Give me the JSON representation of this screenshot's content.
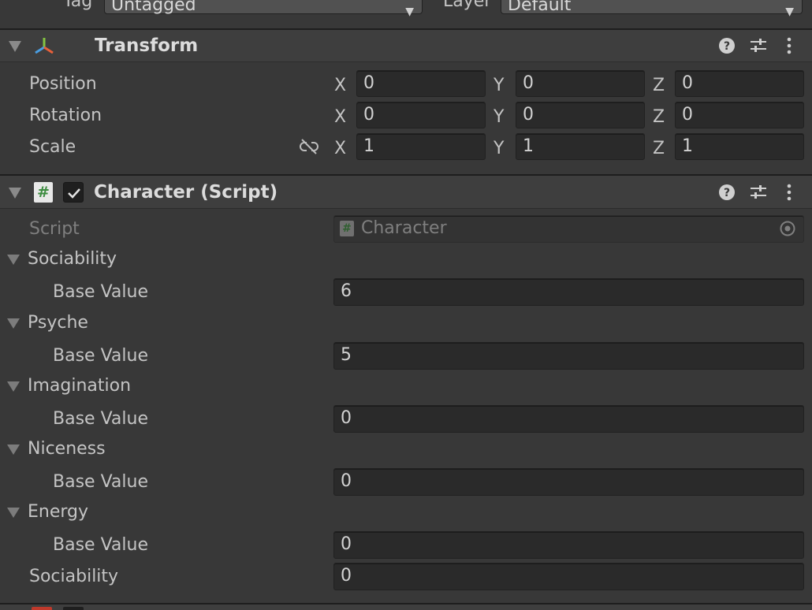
{
  "top": {
    "tag_label": "Tag",
    "tag_value": "Untagged",
    "layer_label": "Layer",
    "layer_value": "Default"
  },
  "transform": {
    "title": "Transform",
    "rows": [
      {
        "label": "Position",
        "x": "0",
        "y": "0",
        "z": "0"
      },
      {
        "label": "Rotation",
        "x": "0",
        "y": "0",
        "z": "0"
      },
      {
        "label": "Scale",
        "x": "1",
        "y": "1",
        "z": "1"
      }
    ],
    "axes": {
      "x": "X",
      "y": "Y",
      "z": "Z"
    }
  },
  "script_component": {
    "title": "Character (Script)",
    "script_label": "Script",
    "script_value": "Character",
    "groups": [
      {
        "name": "Sociability",
        "field_label": "Base Value",
        "value": "6"
      },
      {
        "name": "Psyche",
        "field_label": "Base Value",
        "value": "5"
      },
      {
        "name": "Imagination",
        "field_label": "Base Value",
        "value": "0"
      },
      {
        "name": "Niceness",
        "field_label": "Base Value",
        "value": "0"
      },
      {
        "name": "Energy",
        "field_label": "Base Value",
        "value": "0"
      }
    ],
    "extra_field": {
      "label": "Sociability",
      "value": "0"
    }
  },
  "colors": {
    "background": "#383838",
    "header": "#3e3e3e",
    "field": "#2a2a2a",
    "hash_green": "#3d8c40"
  }
}
